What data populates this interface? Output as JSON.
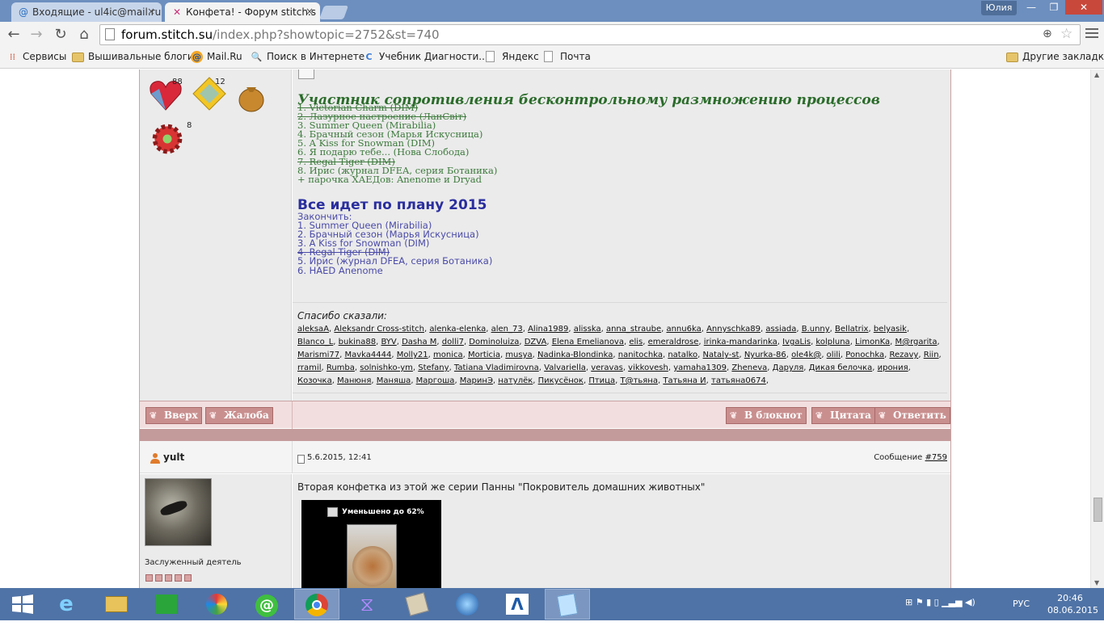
{
  "browser": {
    "tabs": [
      {
        "label": "Входящие - ul4ic@mail.ru"
      },
      {
        "label": "Конфета! - Форум stitch.s"
      }
    ],
    "user_label": "Юлия",
    "url_host": "forum.stitch.su",
    "url_rest": "/index.php?showtopic=2752&st=740"
  },
  "bookmarks": [
    {
      "label": "Сервисы",
      "icon": "apps-grid-icon"
    },
    {
      "label": "Вышивальные блоги",
      "icon": "folder-icon"
    },
    {
      "label": "Mail.Ru",
      "icon": "mailru-icon"
    },
    {
      "label": "Поиск в Интернете",
      "icon": "search-icon"
    },
    {
      "label": "Учебник Диагности...",
      "icon": "google-icon"
    },
    {
      "label": "Яндекс",
      "icon": "page-icon"
    },
    {
      "label": "Почта",
      "icon": "page-icon"
    },
    {
      "label": "Другие закладки",
      "icon": "folder-icon"
    }
  ],
  "awards": {
    "heart_count": "88",
    "diamond_count": "12",
    "gear_count": "8"
  },
  "signature": {
    "heading1": "Участник сопротивления бесконтрольному размножению процессов",
    "list1": [
      {
        "text": "1. Victorian Charm (DIM)",
        "struck": true
      },
      {
        "text": "2. Лазурное настроение (ЛанСвiт)",
        "struck": true
      },
      {
        "text": "3. Summer Queen (Mirabilia)",
        "struck": false
      },
      {
        "text": "4. Брачный сезон (Марья Искусница)",
        "struck": false
      },
      {
        "text": "5. A Kiss for Snowman (DIM)",
        "struck": false
      },
      {
        "text": "6. Я подарю тебе... (Нова Слобода)",
        "struck": false
      },
      {
        "text": "7. Regal Tiger (DIM)",
        "struck": true
      },
      {
        "text": "8. Ирис (журнал DFEA, серия Ботаника)",
        "struck": false
      },
      {
        "text": "+ парочка ХАЕДов: Anenome и Dryad",
        "struck": false
      }
    ],
    "heading2": "Все идет по плану 2015",
    "list2": [
      {
        "text": "Закончить:",
        "struck": false
      },
      {
        "text": "1. Summer Queen (Mirabilia)",
        "struck": false
      },
      {
        "text": "2. Брачный сезон (Марья Искусница)",
        "struck": false
      },
      {
        "text": "3. A Kiss for Snowman (DIM)",
        "struck": false
      },
      {
        "text": "4. Regal Tiger (DIM)",
        "struck": true
      },
      {
        "text": "5. Ирис (журнал DFEA, серия Ботаника)",
        "struck": false
      },
      {
        "text": "6. HAED Anenome",
        "struck": false
      }
    ]
  },
  "thanks": {
    "title": "Спасибо сказали:",
    "users": [
      "aleksaA",
      "Aleksandr Cross-stitch",
      "alenka-elenka",
      "alen_73",
      "Alina1989",
      "alisska",
      "anna_straube",
      "annu6ka",
      "Annyschka89",
      "assiada",
      "B.unny",
      "Bellatrix",
      "belyasik",
      "Blanco_L",
      "bukina88",
      "BYV",
      "Dasha M",
      "dolli7",
      "Dominoluiza",
      "DZVA",
      "Elena Emelianova",
      "elis",
      "emeraldrose",
      "irinka-mandarinka",
      "IvgaLis",
      "kolpluna",
      "LimonKa",
      "M@rgarita",
      "Marismi77",
      "Mavka4444",
      "Molly21",
      "monica",
      "Morticia",
      "musya",
      "Nadinka-Blondinka",
      "nanitochka",
      "natalko",
      "Nataly-st",
      "Nyurka-86",
      "ole4k@",
      "olili",
      "Ponochka",
      "Rezavy",
      "Riin",
      "rramil",
      "Rumba",
      "solnishko-ym",
      "Stefany",
      "Tatiana Vladimirovna",
      "Valvariella",
      "veravas",
      "vikkovesh",
      "yamaha1309",
      "Zheneva",
      "Даруля",
      "Дикая белочка",
      "ирония",
      "Козочка",
      "Манюня",
      "Маняша",
      "Маргоша",
      "МаринЭ",
      "натулёк",
      "Пикусёнок",
      "Птица",
      "T@тьяна",
      "Татьяна И",
      "татьяна0674"
    ]
  },
  "post_buttons": {
    "up": "Вверх",
    "complain": "Жалоба",
    "notepad": "В блокнот",
    "quote": "Цитата",
    "reply": "Ответить"
  },
  "next_post": {
    "author": "yult",
    "date": "5.6.2015, 12:41",
    "message_label": "Сообщение",
    "message_num": "#759",
    "rank": "Заслуженный деятель",
    "text": "Вторая конфетка из этой же серии Панны \"Покровитель домашних животных\"",
    "image_note": "Уменьшено до 62%"
  },
  "taskbar": {
    "lang": "РУС",
    "time": "20:46",
    "date": "08.06.2015"
  }
}
